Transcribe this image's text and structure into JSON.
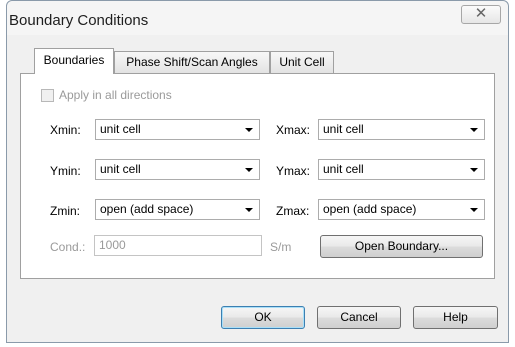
{
  "window": {
    "title": "Boundary Conditions",
    "close_glyph": "✕"
  },
  "tabs": [
    {
      "label": "Boundaries",
      "active": true
    },
    {
      "label": "Phase Shift/Scan Angles",
      "active": false
    },
    {
      "label": "Unit Cell",
      "active": false
    }
  ],
  "apply_all": {
    "label": "Apply in all directions",
    "checked": false,
    "enabled": false
  },
  "fields": {
    "xmin": {
      "label": "Xmin:",
      "value": "unit cell"
    },
    "xmax": {
      "label": "Xmax:",
      "value": "unit cell"
    },
    "ymin": {
      "label": "Ymin:",
      "value": "unit cell"
    },
    "ymax": {
      "label": "Ymax:",
      "value": "unit cell"
    },
    "zmin": {
      "label": "Zmin:",
      "value": "open (add space)"
    },
    "zmax": {
      "label": "Zmax:",
      "value": "open (add space)"
    }
  },
  "conductivity": {
    "label": "Cond.:",
    "value": "1000",
    "unit": "S/m"
  },
  "buttons": {
    "open_boundary": "Open Boundary...",
    "ok": "OK",
    "cancel": "Cancel",
    "help": "Help"
  },
  "colors": {
    "focus_border": "#3c7fb1",
    "disabled_text": "#9a9a9a"
  }
}
